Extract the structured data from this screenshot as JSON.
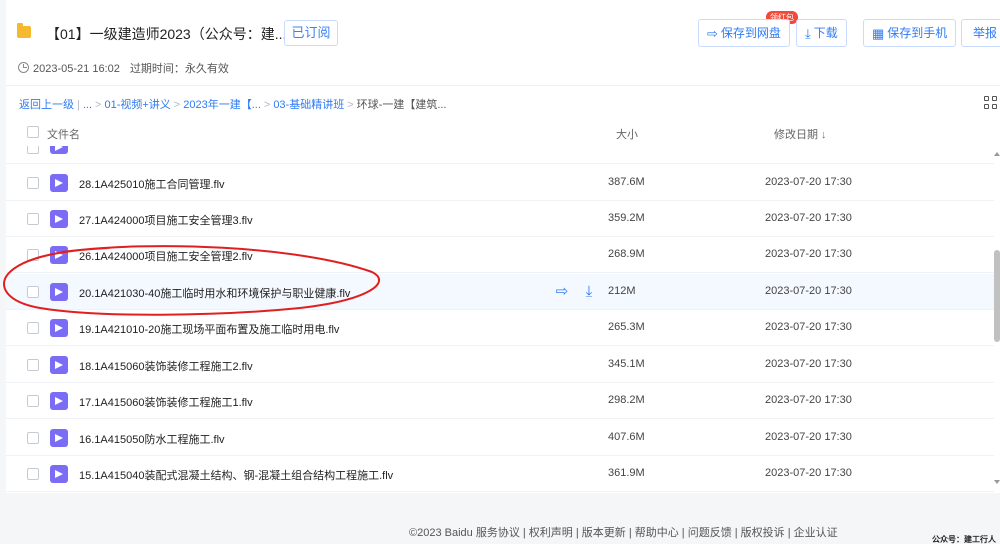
{
  "header": {
    "title": "【01】一级建造师2023（公众号：建...",
    "subscribed_label": "已订阅",
    "badge": "领红包",
    "save_to_cloud": "保存到网盘",
    "download": "下载",
    "save_to_phone": "保存到手机",
    "report": "举报"
  },
  "meta": {
    "date": "2023-05-21 16:02",
    "expire": "过期时间：永久有效"
  },
  "breadcrumb": {
    "back": "返回上一级",
    "items": [
      "...",
      "01-视频+讲义",
      "2023年一建【...",
      "03-基础精讲班"
    ],
    "current": "环球-一建【建筑..."
  },
  "columns": {
    "name": "文件名",
    "size": "大小",
    "date": "修改日期"
  },
  "files": [
    {
      "name": "28.1A425010施工合同管理.flv",
      "size": "387.6M",
      "date": "2023-07-20 17:30"
    },
    {
      "name": "27.1A424000项目施工安全管理3.flv",
      "size": "359.2M",
      "date": "2023-07-20 17:30"
    },
    {
      "name": "26.1A424000项目施工安全管理2.flv",
      "size": "268.9M",
      "date": "2023-07-20 17:30"
    },
    {
      "name": "20.1A421030-40施工临时用水和环境保护与职业健康.flv",
      "size": "212M",
      "date": "2023-07-20 17:30"
    },
    {
      "name": "19.1A421010-20施工现场平面布置及施工临时用电.flv",
      "size": "265.3M",
      "date": "2023-07-20 17:30"
    },
    {
      "name": "18.1A415060装饰装修工程施工2.flv",
      "size": "345.1M",
      "date": "2023-07-20 17:30"
    },
    {
      "name": "17.1A415060装饰装修工程施工1.flv",
      "size": "298.2M",
      "date": "2023-07-20 17:30"
    },
    {
      "name": "16.1A415050防水工程施工.flv",
      "size": "407.6M",
      "date": "2023-07-20 17:30"
    },
    {
      "name": "15.1A415040装配式混凝土结构、钢-混凝土组合结构工程施工.flv",
      "size": "361.9M",
      "date": "2023-07-20 17:30"
    }
  ],
  "footer": "©2023 Baidu  服务协议 | 权利声明 | 版本更新 | 帮助中心 | 问题反馈 | 版权投诉 | 企业认证",
  "watermark": "公众号：建工行人",
  "colors": {
    "accent": "#2f7bf5",
    "video_icon": "#7b6cf6",
    "annotation": "#e02020"
  }
}
